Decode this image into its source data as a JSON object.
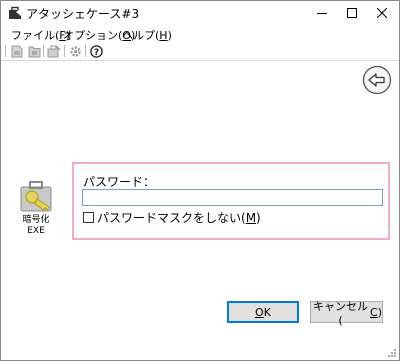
{
  "window": {
    "title": "アタッシェケース#3"
  },
  "menu": {
    "file": {
      "label": "ファイル(",
      "mnemonic": "F",
      "suffix": ")"
    },
    "option": {
      "label": "オプション(",
      "mnemonic": "O",
      "suffix": ")"
    },
    "help": {
      "label": "ヘルプ(",
      "mnemonic": "H",
      "suffix": ")"
    }
  },
  "toolbar": {
    "help_glyph": "?"
  },
  "main": {
    "exe_label": "暗号化\nEXE",
    "password_label": "パスワード：",
    "password_value": "",
    "mask_label": "パスワードマスクをしない(",
    "mask_mnemonic": "M",
    "mask_suffix": ")",
    "mask_checked": false
  },
  "buttons": {
    "ok_mnemonic": "O",
    "ok_rest": "K",
    "cancel_label": "キャンセル(",
    "cancel_mnemonic": "C",
    "cancel_suffix": ")"
  },
  "icons": {
    "app": "briefcase-icon",
    "toolbar": [
      "encrypt-file-icon",
      "decrypt-file-icon",
      "delete-icon",
      "settings-icon",
      "help-icon"
    ],
    "back": "back-arrow-icon",
    "exe": "key-briefcase-icon"
  },
  "colors": {
    "panel_border": "#f4a9c4",
    "ok_border": "#0078d7",
    "input_border": "#7a9cc6"
  }
}
